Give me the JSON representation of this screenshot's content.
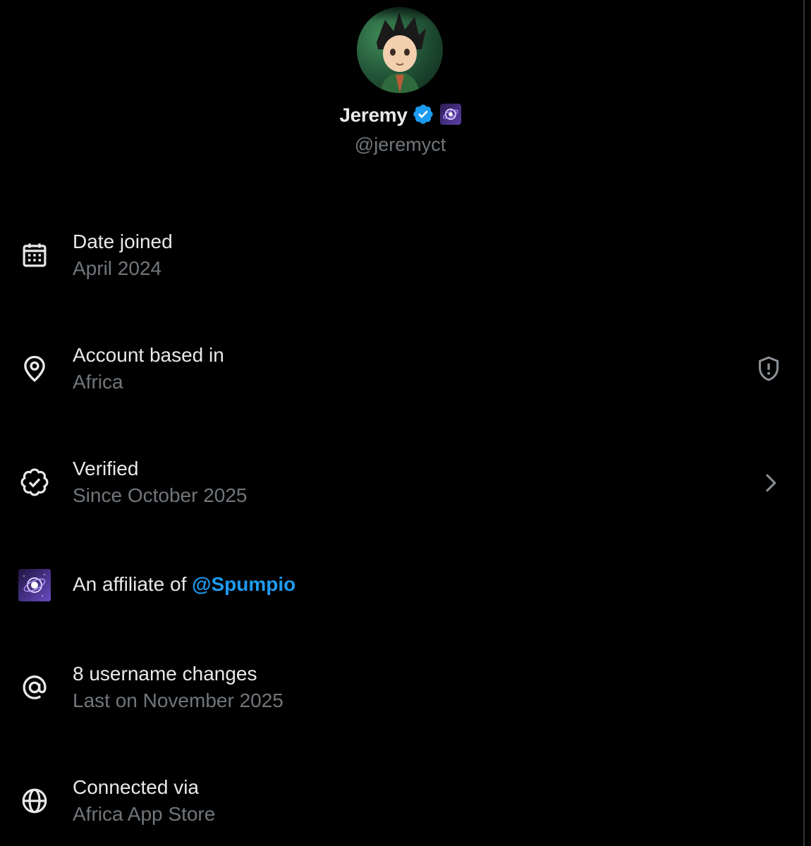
{
  "profile": {
    "name": "Jeremy",
    "handle": "@jeremyct"
  },
  "rows": {
    "date_joined": {
      "title": "Date joined",
      "value": "April 2024",
      "icon": "calendar-icon"
    },
    "based_in": {
      "title": "Account based in",
      "value": "Africa",
      "icon": "location-pin-icon",
      "trailing_icon": "shield-alert-icon"
    },
    "verified": {
      "title": "Verified",
      "value": "Since October 2025",
      "icon": "verified-seal-icon",
      "trailing_icon": "chevron-right-icon"
    },
    "affiliate": {
      "prefix": "An affiliate of ",
      "mention": "@Spumpio",
      "icon": "affiliate-badge-icon"
    },
    "username": {
      "title": "8 username changes",
      "value": "Last on November 2025",
      "icon": "at-sign-icon"
    },
    "connected": {
      "title": "Connected via",
      "value": "Africa App Store",
      "icon": "globe-icon"
    }
  },
  "colors": {
    "background": "#000000",
    "primary_text": "#e7e9ea",
    "secondary_text": "#71767b",
    "accent": "#1d9bf0"
  }
}
